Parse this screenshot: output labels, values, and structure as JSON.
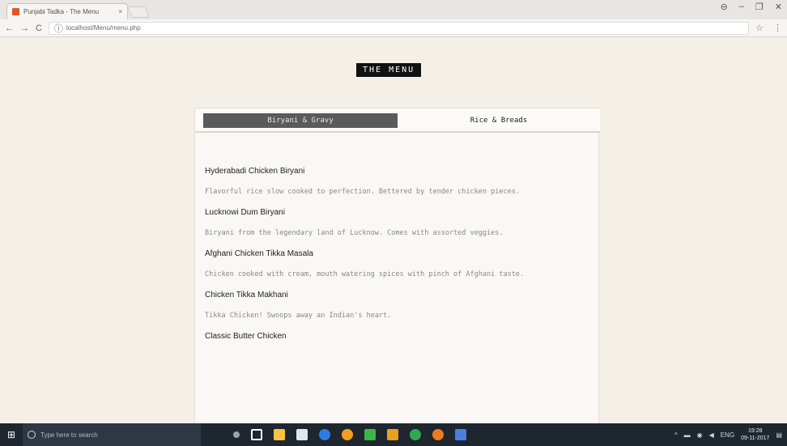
{
  "browser": {
    "tab_title": "Punjabi Tadka - The Menu",
    "tab_close": "×",
    "url": "localhost/Menu/menu.php",
    "win_controls": [
      "⊖",
      "–",
      "❐",
      "✕"
    ]
  },
  "page": {
    "title": "THE MENU",
    "tabs": [
      {
        "label": "Biryani & Gravy",
        "active": true
      },
      {
        "label": "Rice & Breads",
        "active": false
      }
    ],
    "items": [
      {
        "name": "Hyderabadi Chicken Biryani",
        "desc": "Flavorful rice slow cooked to perfection. Bettered by tender chicken pieces."
      },
      {
        "name": "Lucknowi Dum Biryani",
        "desc": "Biryani from the legendary land of Lucknow. Comes with assorted veggies."
      },
      {
        "name": "Afghani Chicken Tikka Masala",
        "desc": "Chicken cooked with cream, mouth watering spices with pinch of Afghani taste."
      },
      {
        "name": "Chicken Tikka Makhani",
        "desc": "Tikka Chicken! Swoops away an Indian's heart."
      },
      {
        "name": "Classic Butter Chicken",
        "desc": ""
      }
    ]
  },
  "taskbar": {
    "search_placeholder": "Type here to search",
    "time": "19:28",
    "date": "09-11-2017",
    "lang": "ENG",
    "app_colors": [
      "#9aa3ad",
      "#ffffff",
      "#f5c542",
      "#dfe6ee",
      "#2d7de0",
      "#f0a020",
      "#3db34a",
      "#e8a020",
      "#2fa84f",
      "#f07a20",
      "#4a7fe0"
    ]
  }
}
